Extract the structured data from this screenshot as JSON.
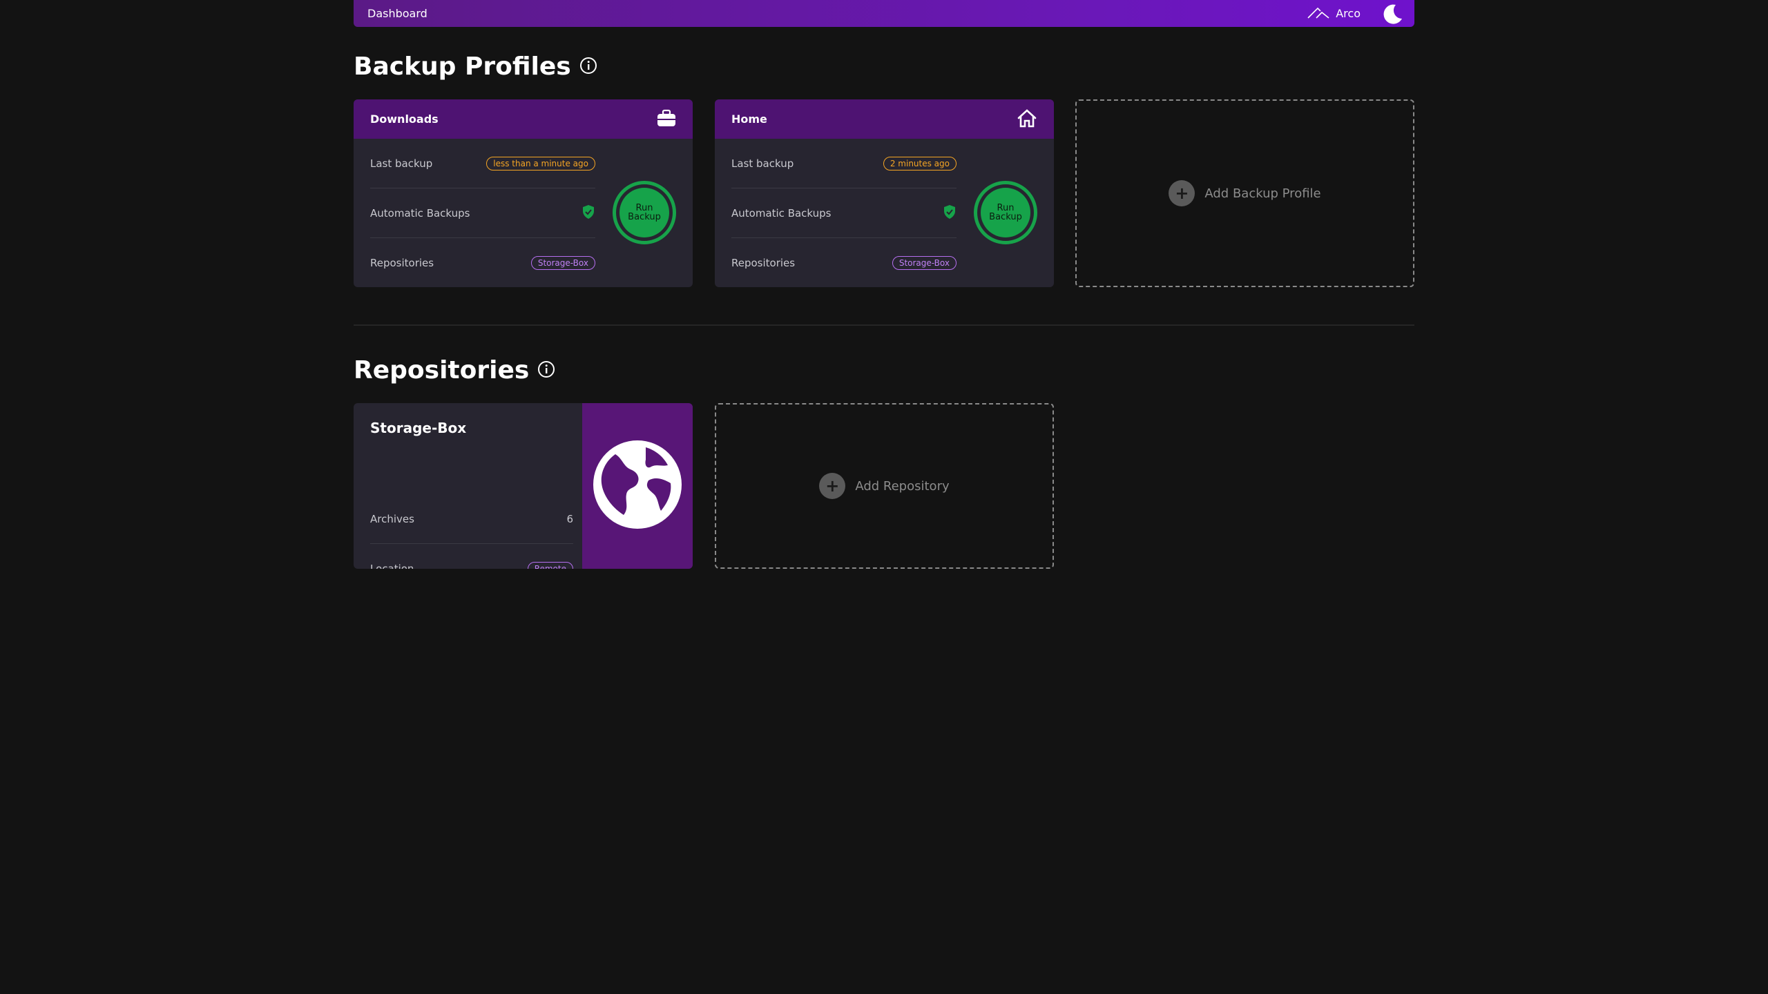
{
  "topbar": {
    "breadcrumb": "Dashboard",
    "user_name": "Arco",
    "theme_icon": "moon-icon"
  },
  "profiles_section": {
    "title": "Backup Profiles",
    "info_icon": "info-icon"
  },
  "profiles": [
    {
      "name": "Downloads",
      "icon": "briefcase-icon",
      "last_backup_label": "Last backup",
      "last_backup_value": "less than a minute ago",
      "auto_label": "Automatic Backups",
      "auto_icon": "shield-check-icon",
      "repos_label": "Repositories",
      "repos_value": "Storage-Box",
      "run_line1": "Run",
      "run_line2": "Backup"
    },
    {
      "name": "Home",
      "icon": "home-icon",
      "last_backup_label": "Last backup",
      "last_backup_value": "2 minutes ago",
      "auto_label": "Automatic Backups",
      "auto_icon": "shield-check-icon",
      "repos_label": "Repositories",
      "repos_value": "Storage-Box",
      "run_line1": "Run",
      "run_line2": "Backup"
    }
  ],
  "add_profile_label": "Add Backup Profile",
  "repos_section": {
    "title": "Repositories",
    "info_icon": "info-icon"
  },
  "repositories": [
    {
      "name": "Storage-Box",
      "archives_label": "Archives",
      "archives_value": "6",
      "location_label": "Location",
      "location_value": "Remote",
      "icon": "globe-icon"
    }
  ],
  "add_repo_label": "Add Repository",
  "colors": {
    "accent": "#6a18b8",
    "card_header": "#4e1372",
    "success": "#16a34a",
    "warning": "#f5a524",
    "tag": "#b66ff0"
  }
}
